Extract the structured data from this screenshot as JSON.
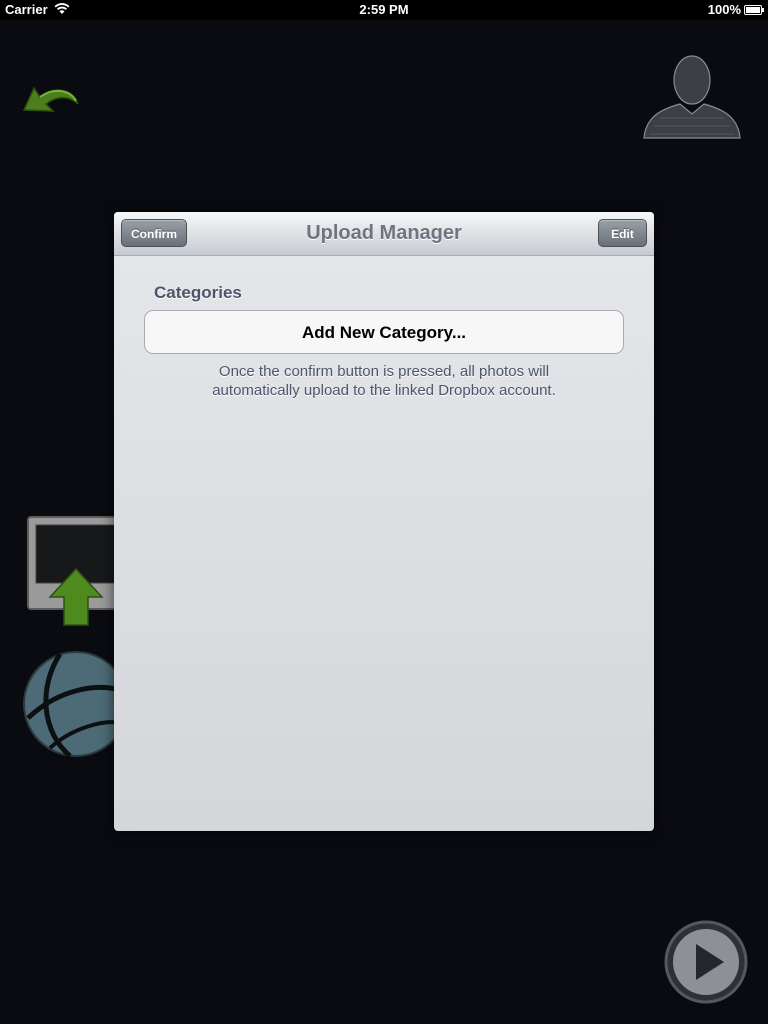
{
  "status_bar": {
    "carrier": "Carrier",
    "time": "2:59 PM",
    "battery": "100%"
  },
  "modal": {
    "title": "Upload Manager",
    "left_button": "Confirm",
    "right_button": "Edit",
    "section_header": "Categories",
    "add_category": "Add New Category...",
    "footer": "Once the confirm button is pressed, all photos will automatically upload to the linked Dropbox account."
  },
  "icons": {
    "back": "back-arrow-icon",
    "profile": "profile-icon",
    "upload": "upload-screen-icon",
    "globe": "globe-icon",
    "play": "play-icon"
  },
  "colors": {
    "background": "#0a0b10",
    "accent_green": "#4f8a1e",
    "modal_bg": "#dfe1e5",
    "nav_button": "#7a8089"
  }
}
